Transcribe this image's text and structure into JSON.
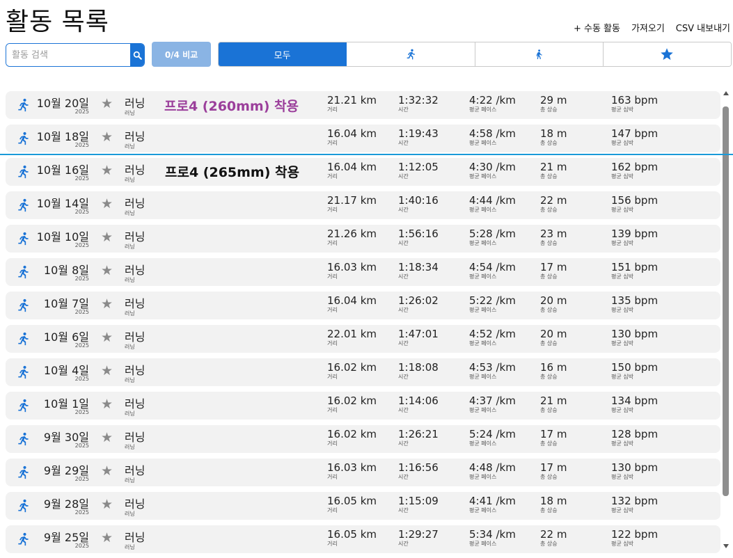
{
  "header": {
    "title": "활동 목록",
    "actions": [
      "+ 수동 활동",
      "가져오기",
      "CSV 내보내기"
    ]
  },
  "toolbar": {
    "search_placeholder": "활동 검색",
    "compare_label": "0/4 비교",
    "filters": [
      {
        "label": "모두",
        "icon": null,
        "active": true
      },
      {
        "label": "",
        "icon": "running-icon",
        "active": false
      },
      {
        "label": "",
        "icon": "walking-icon",
        "active": false
      },
      {
        "label": "",
        "icon": "star-icon",
        "active": false
      }
    ]
  },
  "annotations": [
    {
      "text": "프로4 (260mm) 착용",
      "color": "#9b3f9b"
    },
    {
      "text": "프로4 (265mm) 착용",
      "color": "#111111"
    }
  ],
  "labels": {
    "distance": "거리",
    "time": "시간",
    "pace": "평균 페이스",
    "elevation": "총 상승",
    "heart_rate": "평균 심박"
  },
  "activities": [
    {
      "date": "10월 20일",
      "year": "2025",
      "type": "러닝",
      "type_sub": "러닝",
      "distance": "21.21 km",
      "time": "1:32:32",
      "pace": "4:22 /km",
      "elevation": "29 m",
      "heart_rate": "163 bpm"
    },
    {
      "date": "10월 18일",
      "year": "2025",
      "type": "러닝",
      "type_sub": "러닝",
      "distance": "16.04 km",
      "time": "1:19:43",
      "pace": "4:58 /km",
      "elevation": "18 m",
      "heart_rate": "147 bpm"
    },
    {
      "date": "10월 16일",
      "year": "2025",
      "type": "러닝",
      "type_sub": "러닝",
      "distance": "16.04 km",
      "time": "1:12:05",
      "pace": "4:30 /km",
      "elevation": "21 m",
      "heart_rate": "162 bpm"
    },
    {
      "date": "10월 14일",
      "year": "2025",
      "type": "러닝",
      "type_sub": "러닝",
      "distance": "21.17 km",
      "time": "1:40:16",
      "pace": "4:44 /km",
      "elevation": "22 m",
      "heart_rate": "156 bpm"
    },
    {
      "date": "10월 10일",
      "year": "2025",
      "type": "러닝",
      "type_sub": "러닝",
      "distance": "21.26 km",
      "time": "1:56:16",
      "pace": "5:28 /km",
      "elevation": "23 m",
      "heart_rate": "139 bpm"
    },
    {
      "date": "10월 8일",
      "year": "2025",
      "type": "러닝",
      "type_sub": "러닝",
      "distance": "16.03 km",
      "time": "1:18:34",
      "pace": "4:54 /km",
      "elevation": "17 m",
      "heart_rate": "151 bpm"
    },
    {
      "date": "10월 7일",
      "year": "2025",
      "type": "러닝",
      "type_sub": "러닝",
      "distance": "16.04 km",
      "time": "1:26:02",
      "pace": "5:22 /km",
      "elevation": "20 m",
      "heart_rate": "135 bpm"
    },
    {
      "date": "10월 6일",
      "year": "2025",
      "type": "러닝",
      "type_sub": "러닝",
      "distance": "22.01 km",
      "time": "1:47:01",
      "pace": "4:52 /km",
      "elevation": "20 m",
      "heart_rate": "130 bpm"
    },
    {
      "date": "10월 4일",
      "year": "2025",
      "type": "러닝",
      "type_sub": "러닝",
      "distance": "16.02 km",
      "time": "1:18:08",
      "pace": "4:53 /km",
      "elevation": "16 m",
      "heart_rate": "150 bpm"
    },
    {
      "date": "10월 1일",
      "year": "2025",
      "type": "러닝",
      "type_sub": "러닝",
      "distance": "16.02 km",
      "time": "1:14:06",
      "pace": "4:37 /km",
      "elevation": "21 m",
      "heart_rate": "134 bpm"
    },
    {
      "date": "9월 30일",
      "year": "2025",
      "type": "러닝",
      "type_sub": "러닝",
      "distance": "16.02 km",
      "time": "1:26:21",
      "pace": "5:24 /km",
      "elevation": "17 m",
      "heart_rate": "128 bpm"
    },
    {
      "date": "9월 29일",
      "year": "2025",
      "type": "러닝",
      "type_sub": "러닝",
      "distance": "16.03 km",
      "time": "1:16:56",
      "pace": "4:48 /km",
      "elevation": "17 m",
      "heart_rate": "130 bpm"
    },
    {
      "date": "9월 28일",
      "year": "2025",
      "type": "러닝",
      "type_sub": "러닝",
      "distance": "16.05 km",
      "time": "1:15:09",
      "pace": "4:41 /km",
      "elevation": "18 m",
      "heart_rate": "132 bpm"
    },
    {
      "date": "9월 25일",
      "year": "2025",
      "type": "러닝",
      "type_sub": "러닝",
      "distance": "16.05 km",
      "time": "1:29:27",
      "pace": "5:34 /km",
      "elevation": "22 m",
      "heart_rate": "122 bpm"
    }
  ],
  "colors": {
    "accent": "#1a73d6",
    "compare_button": "#8ab4e4",
    "row_background": "#f2f2f2",
    "divider": "#1a9ad8",
    "annotation_purple": "#9b3f9b"
  }
}
